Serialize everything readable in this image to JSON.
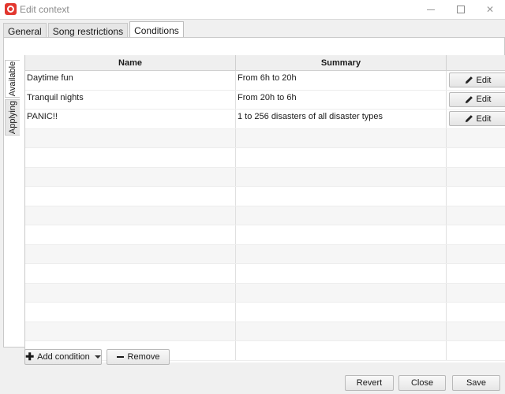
{
  "window": {
    "title": "Edit context",
    "controls": [
      "minimize",
      "maximize",
      "close"
    ]
  },
  "tabs": [
    {
      "label": "General",
      "active": false
    },
    {
      "label": "Song restrictions",
      "active": false
    },
    {
      "label": "Conditions",
      "active": true
    }
  ],
  "side_tabs": [
    {
      "label": "Available",
      "active": true
    },
    {
      "label": "Applying",
      "active": false
    }
  ],
  "table": {
    "headers": {
      "name": "Name",
      "summary": "Summary",
      "action": ""
    },
    "rows": [
      {
        "name": "Daytime fun",
        "summary": "From 6h to 20h",
        "action": "Edit"
      },
      {
        "name": "Tranquil nights",
        "summary": "From 20h to 6h",
        "action": "Edit"
      },
      {
        "name": "PANIC!!",
        "summary": "1 to 256 disasters of all disaster types",
        "action": "Edit"
      }
    ]
  },
  "conditions_buttons": {
    "add": "Add condition",
    "remove": "Remove"
  },
  "dialog_buttons": {
    "revert": "Revert",
    "close": "Close",
    "save": "Save"
  },
  "colors": {
    "app_icon": "#e2372f",
    "window_bg": "#f0f0f0"
  }
}
